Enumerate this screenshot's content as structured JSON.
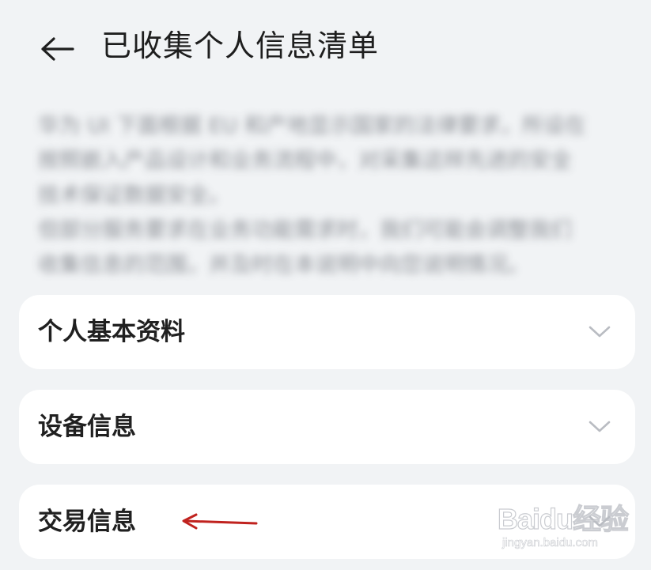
{
  "header": {
    "back_icon": "arrow-left-icon",
    "title": "已收集个人信息清单"
  },
  "description": {
    "lines": [
      "华为 UI 下面根据 EU 和产地显示国家的法律要求，所设在",
      "按照嵌入产品设计和业务流程中，对采集这样先进的安全",
      "技术保证数据安全。",
      "但部分服务要求在业务功能需求时，我们可能会调整我们",
      "收集信息的范围，并及时在本说明中向您说明情况。"
    ]
  },
  "cards": [
    {
      "label": "个人基本资料",
      "icon": "chevron-down-icon"
    },
    {
      "label": "设备信息",
      "icon": "chevron-down-icon"
    },
    {
      "label": "交易信息",
      "icon": "chevron-down-icon"
    }
  ],
  "annotation": {
    "color": "#c0221e",
    "icon": "red-arrow-annotation"
  },
  "watermark": {
    "logo": "Baidu经验",
    "url": "jingyan.baidu.com"
  },
  "colors": {
    "background": "#f1f3f5",
    "card": "#ffffff",
    "chevron": "#b9bcc2",
    "annotation": "#c0221e"
  }
}
